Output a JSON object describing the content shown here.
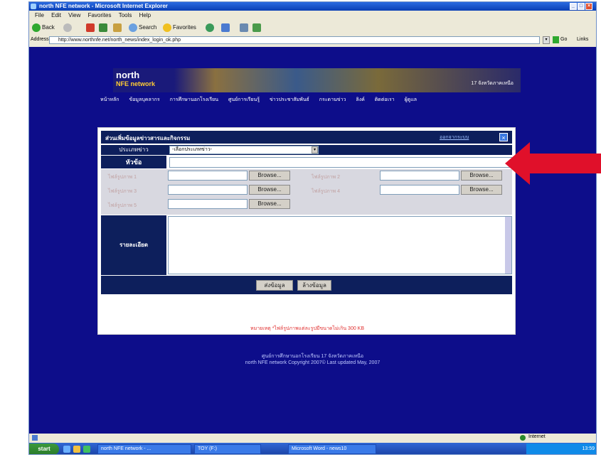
{
  "window": {
    "title": "north NFE network - Microsoft Internet Explorer"
  },
  "menu": [
    "File",
    "Edit",
    "View",
    "Favorites",
    "Tools",
    "Help"
  ],
  "toolbar": {
    "back": "Back",
    "search": "Search",
    "favorites": "Favorites"
  },
  "address": {
    "label": "Address",
    "url": "http://www.northnfe.net/north_news/index_login_ok.php",
    "go": "Go",
    "links": "Links"
  },
  "banner": {
    "logo_top": "north",
    "logo_bottom": "NFE network",
    "tagline": "17 จังหวัดภาคเหนือ"
  },
  "nav": [
    "หน้าหลัก",
    "ข้อมูลบุคลากร",
    "การศึกษานอกโรงเรียน",
    "ศูนย์การเรียนรู้",
    "ข่าวประชาสัมพันธ์",
    "กระดานข่าว",
    "ลิงค์",
    "ติดต่อเรา",
    "ผู้ดูแล"
  ],
  "form": {
    "title": "ส่วนเพิ่มข้อมูลข่าวสารและกิจกรรม",
    "logout_link": "ออกจากระบบ",
    "category_label": "ประเภทข่าว",
    "category_value": "-เลือกประเภทข่าว-",
    "subject_label": "หัวข้อ",
    "subject_value": "",
    "file_labels": [
      "ไฟล์รูปภาพ 1",
      "ไฟล์รูปภาพ 2",
      "ไฟล์รูปภาพ 3",
      "ไฟล์รูปภาพ 4",
      "ไฟล์รูปภาพ 5"
    ],
    "browse_label": "Browse...",
    "detail_label": "รายละเอียด",
    "submit_label": "ส่งข้อมูล",
    "reset_label": "ล้างข้อมูล",
    "note": "หมายเหตุ *ไฟล์รูปภาพแต่ละรูปมีขนาดไม่เกิน 300 KB"
  },
  "footer": {
    "line1": "ศูนย์การศึกษานอกโรงเรียน 17 จังหวัดภาคเหนือ",
    "line2": "north NFE network Copyright 2007© Last updated May, 2007"
  },
  "status": {
    "zone": "Internet"
  },
  "taskbar": {
    "start": "start",
    "tasks": [
      "north NFE network - ...",
      "TOY (F:)",
      "Microsoft Word - news10"
    ],
    "clock": "13:59"
  },
  "colors": {
    "page_bg": "#0d0d8a",
    "header_bg": "#0d1f5c",
    "arrow": "#e0102a"
  }
}
